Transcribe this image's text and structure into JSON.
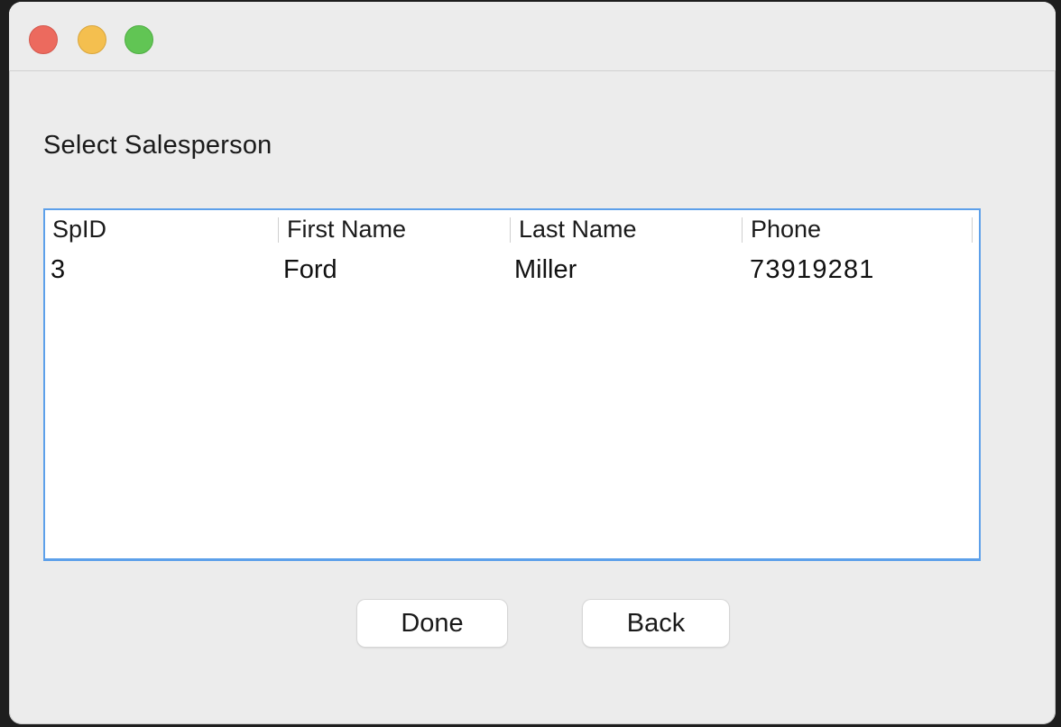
{
  "window": {
    "controls": [
      "close",
      "minimize",
      "zoom"
    ]
  },
  "heading": "Select Salesperson",
  "table": {
    "columns": [
      "SpID",
      "First Name",
      "Last Name",
      "Phone"
    ],
    "rows": [
      [
        "3",
        "Ford",
        "Miller",
        "73919281"
      ]
    ]
  },
  "buttons": {
    "done_label": "Done",
    "back_label": "Back"
  },
  "colors": {
    "close": "#ec6a5e",
    "minimize": "#f4bf4f",
    "zoom": "#61c554",
    "focus_border": "#5da0ea"
  }
}
